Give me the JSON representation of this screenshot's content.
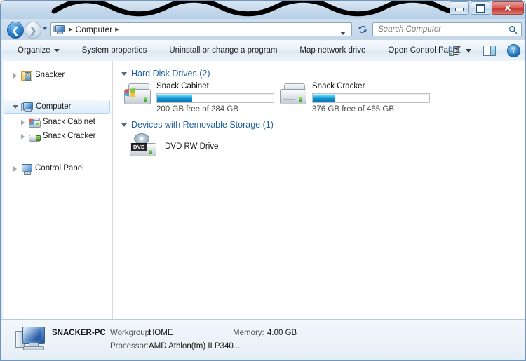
{
  "window": {
    "title_obscured": true,
    "controls": {
      "minimize": "Minimize",
      "maximize": "Maximize",
      "close": "Close"
    }
  },
  "navigation": {
    "back_label": "Back",
    "forward_label": "Forward",
    "history_label": "Recent pages",
    "refresh_label": "Refresh",
    "breadcrumb": {
      "icon": "computer-icon",
      "separator": "▸",
      "items": [
        "Computer"
      ]
    }
  },
  "search": {
    "placeholder": "Search Computer",
    "value": "",
    "icon": "search-icon"
  },
  "command_bar": {
    "items": [
      {
        "label": "Organize",
        "has_caret": true
      },
      {
        "label": "System properties",
        "has_caret": false
      },
      {
        "label": "Uninstall or change a program",
        "has_caret": false
      },
      {
        "label": "Map network drive",
        "has_caret": false
      },
      {
        "label": "Open Control Panel",
        "has_caret": false
      }
    ],
    "view_icon": "view-options-icon",
    "view_caret": "chevron-down-icon",
    "preview_pane_icon": "preview-pane-icon",
    "help_icon": "help-icon",
    "help_label": "?"
  },
  "sidebar": {
    "items": [
      {
        "label": "Snacker",
        "icon": "user-folder-icon",
        "state": "collapsed",
        "indent": 0,
        "selected": false
      },
      {
        "label": "Computer",
        "icon": "computer-icon",
        "state": "expanded",
        "indent": 0,
        "selected": true
      },
      {
        "label": "Snack Cabinet",
        "icon": "hard-drive-icon",
        "state": "collapsed",
        "indent": 1,
        "selected": false
      },
      {
        "label": "Snack Cracker",
        "icon": "removable-drive-icon",
        "state": "collapsed",
        "indent": 1,
        "selected": false
      },
      {
        "label": "Control Panel",
        "icon": "control-panel-icon",
        "state": "collapsed",
        "indent": 0,
        "selected": false
      }
    ]
  },
  "content": {
    "groups": [
      {
        "title": "Hard Disk Drives (2)",
        "expanded": true,
        "drives": [
          {
            "name": "Snack Cabinet",
            "icon": "system-hard-drive-icon",
            "free_text": "200 GB free of 284 GB",
            "free_gb": 200,
            "total_gb": 284,
            "used_percent": 30
          },
          {
            "name": "Snack Cracker",
            "icon": "hard-drive-icon",
            "free_text": "376 GB free of 465 GB",
            "free_gb": 376,
            "total_gb": 465,
            "used_percent": 19
          }
        ]
      },
      {
        "title": "Devices with Removable Storage (1)",
        "expanded": true,
        "devices": [
          {
            "name": "DVD RW Drive",
            "icon": "dvd-drive-icon",
            "badge": "DVD"
          }
        ]
      }
    ]
  },
  "details_pane": {
    "icon": "computer-icon",
    "computer_name": "SNACKER-PC",
    "workgroup_key": "Workgroup:",
    "workgroup_value": "HOME",
    "memory_key": "Memory:",
    "memory_value": "4.00 GB",
    "processor_key": "Processor:",
    "processor_value": "AMD Athlon(tm) II P340..."
  },
  "colors": {
    "accent_blue": "#2362a0",
    "bar_fill": "#0d86c4",
    "frame": "#9dbfdf",
    "close_red": "#c4372f"
  }
}
